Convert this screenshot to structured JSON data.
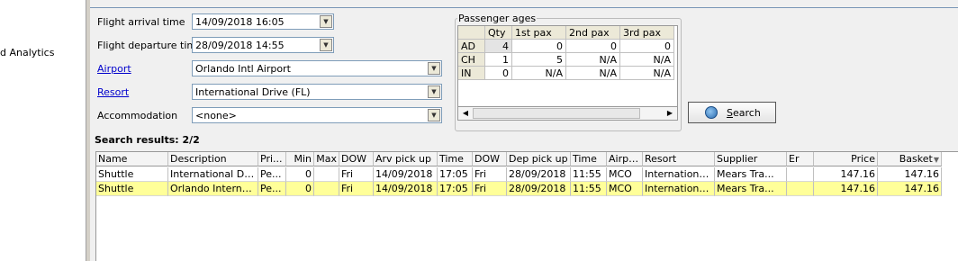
{
  "nav": {
    "item_text": "d Analytics"
  },
  "form": {
    "arrival_label": "Flight arrival time",
    "arrival_value": "14/09/2018 16:05",
    "departure_label": "Flight departure time",
    "departure_value": "28/09/2018 14:55",
    "airport_label": "Airport",
    "airport_value": "Orlando Intl Airport",
    "resort_label": "Resort",
    "resort_value": "International Drive (FL)",
    "accommodation_label": "Accommodation",
    "accommodation_value": "<none>"
  },
  "passengers": {
    "title": "Passenger ages",
    "headers": [
      "",
      "Qty",
      "1st pax",
      "2nd pax",
      "3rd pax"
    ],
    "rows": [
      {
        "type": "AD",
        "qty": "4",
        "p1": "0",
        "p2": "0",
        "p3": "0"
      },
      {
        "type": "CH",
        "qty": "1",
        "p1": "5",
        "p2": "N/A",
        "p3": "N/A"
      },
      {
        "type": "IN",
        "qty": "0",
        "p1": "N/A",
        "p2": "N/A",
        "p3": "N/A"
      }
    ]
  },
  "search_button": {
    "label": "Search",
    "accel": "S"
  },
  "results": {
    "title": "Search results: 2/2",
    "headers": [
      "Name",
      "Description",
      "Pri...",
      "Min",
      "Max",
      "DOW",
      "Arv pick up",
      "Time",
      "DOW",
      "Dep pick up",
      "Time",
      "Airport",
      "Resort",
      "Supplier",
      "Er",
      "Price",
      "Basket"
    ],
    "rows": [
      [
        "Shuttle",
        "International Dri...",
        "Pe...",
        "0",
        "",
        "Fri",
        "14/09/2018",
        "17:05",
        "Fri",
        "28/09/2018",
        "11:55",
        "MCO",
        "International...",
        "Mears Tra...",
        "",
        "147.16",
        "147.16"
      ],
      [
        "Shuttle",
        "Orlando Internat...",
        "Pe...",
        "0",
        "",
        "Fri",
        "14/09/2018",
        "17:05",
        "Fri",
        "28/09/2018",
        "11:55",
        "MCO",
        "International...",
        "Mears Tra...",
        "",
        "147.16",
        "147.16"
      ]
    ]
  },
  "colors": {
    "selected_row": "#ffff99",
    "link": "#0000cc"
  }
}
